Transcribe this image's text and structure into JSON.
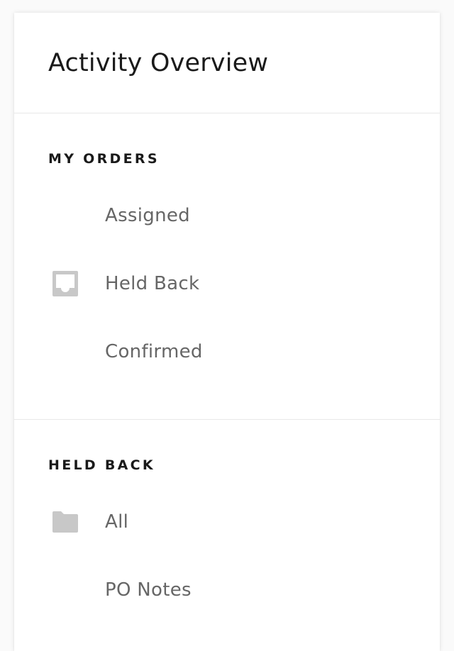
{
  "header": {
    "title": "Activity Overview"
  },
  "sections": [
    {
      "label": "MY ORDERS",
      "items": [
        {
          "label": "Assigned",
          "icon": null
        },
        {
          "label": "Held Back",
          "icon": "inbox-icon"
        },
        {
          "label": "Confirmed",
          "icon": null
        }
      ]
    },
    {
      "label": "HELD BACK",
      "items": [
        {
          "label": "All",
          "icon": "folder-icon"
        },
        {
          "label": "PO Notes",
          "icon": null
        }
      ]
    }
  ],
  "colors": {
    "icon": "#c8c8c8",
    "label": "#666666",
    "heading": "#1a1a1a",
    "divider": "#e8e8e8"
  }
}
